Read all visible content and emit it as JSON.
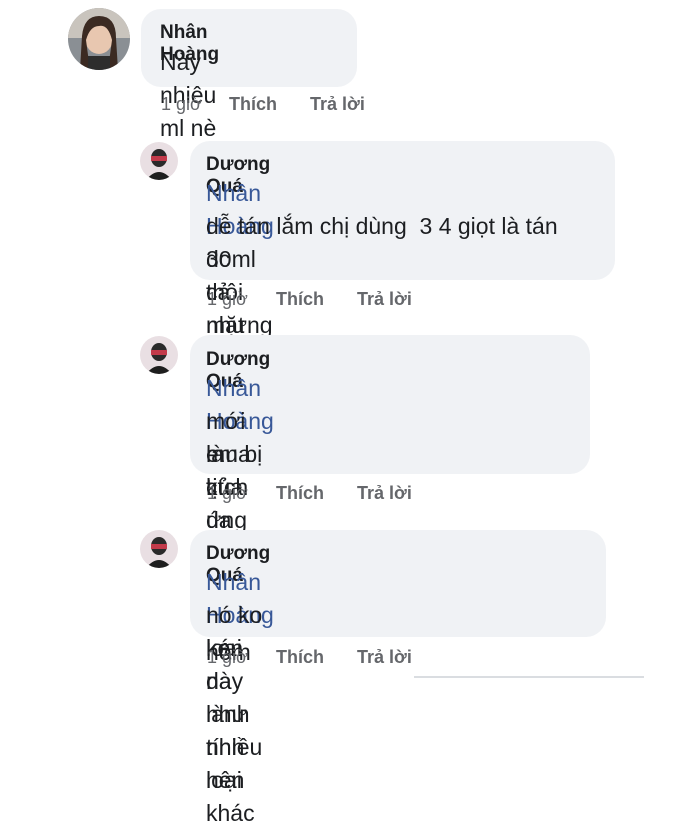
{
  "comments": [
    {
      "author": "Nhân Hoàng",
      "text": "Này nhiêu ml nè",
      "time": "1 giờ",
      "like": "Thích",
      "reply": "Trả lời"
    },
    {
      "author": "Dương Quá",
      "mention": "Nhân Hoàng",
      "line1_rest": " 30ml thôi nhưng nó",
      "line2": "dễ tán lắm chị dùng  3 4 giọt là tán",
      "line3": "dc cả mặt r",
      "time": "1 giờ",
      "like": "Thích",
      "reply": "Trả lời"
    },
    {
      "author": "Dương Quá",
      "mention": "Nhân Hoàng",
      "line1_rest": " em bị kích ứng mà",
      "line2": "mới mua của da liễu dùng 3 hôm",
      "line3": "là tịt",
      "time": "1 giờ",
      "like": "Thích",
      "reply": "Trả lời"
    },
    {
      "author": "Dương Quá",
      "mention": "Nhân Hoàng",
      "line1_rest": " loại này lành tính nên",
      "line2": "nó ko kén da như nhiều loại khác",
      "time": "1 giờ",
      "like": "Thích",
      "reply": "Trả lời"
    }
  ],
  "colors": {
    "bubble": "#f0f2f5",
    "mention": "#385898",
    "meta": "#65676b"
  }
}
